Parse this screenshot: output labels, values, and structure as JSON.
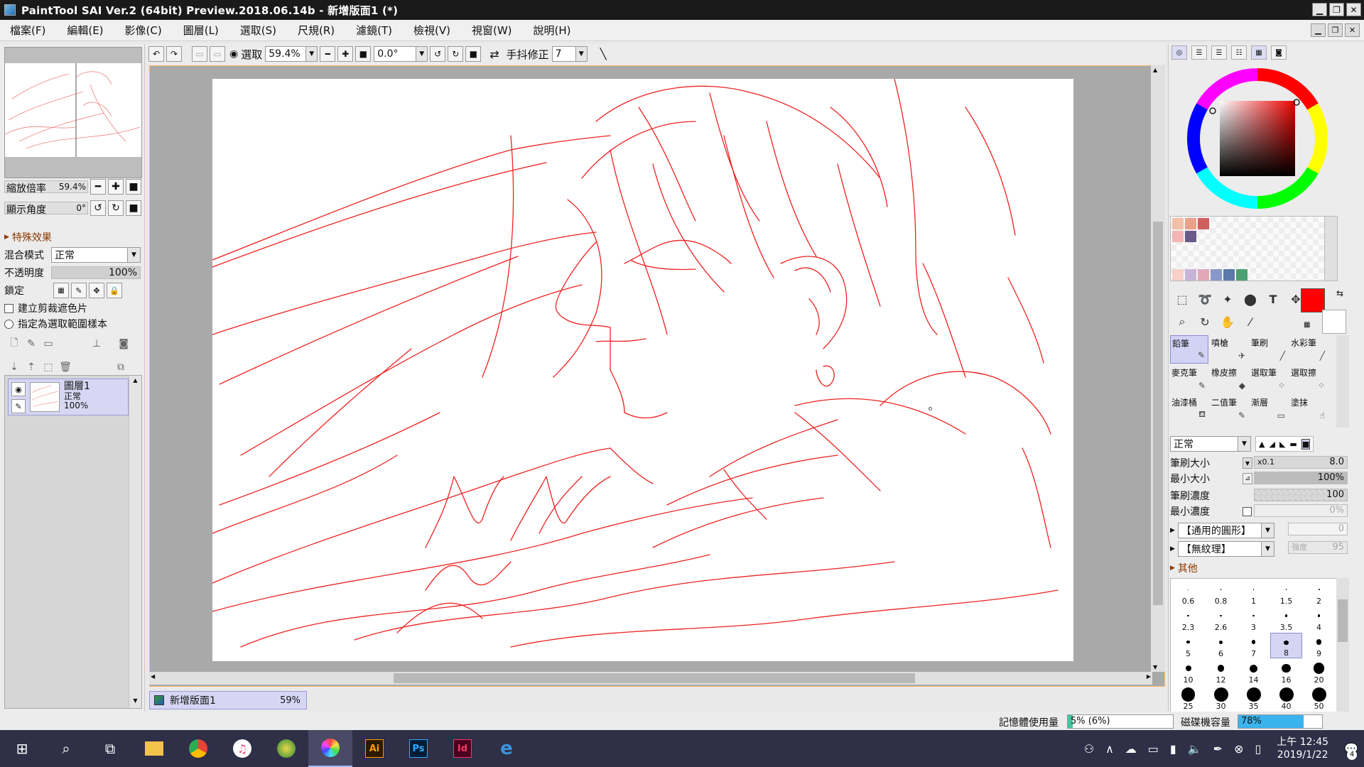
{
  "window": {
    "title": "PaintTool SAI Ver.2 (64bit) Preview.2018.06.14b - 新增版面1 (*)"
  },
  "menu": [
    "檔案(F)",
    "編輯(E)",
    "影像(C)",
    "圖層(L)",
    "選取(S)",
    "尺規(R)",
    "濾鏡(T)",
    "檢視(V)",
    "視窗(W)",
    "說明(H)"
  ],
  "left": {
    "zoom_label": "縮放倍率",
    "zoom_value": "59.4%",
    "angle_label": "顯示角度",
    "angle_value": "0°",
    "effects_label": "特殊效果",
    "blend_label": "混合模式",
    "blend_value": "正常",
    "opacity_label": "不透明度",
    "opacity_value": "100%",
    "opacity_level": 100,
    "lock_label": "鎖定",
    "clip_label": "建立剪裁遮色片",
    "selection_source_label": "指定為選取範圍樣本",
    "layer": {
      "name": "圖層1",
      "mode": "正常",
      "opacity": "100%"
    }
  },
  "toolbar": {
    "selection_label": "選取",
    "zoom": "59.4%",
    "angle": "0.0°",
    "stabilizer_label": "手抖修正",
    "stabilizer_value": "7"
  },
  "document_tab": {
    "name": "新增版面1",
    "zoom": "59%"
  },
  "right": {
    "brushes": [
      {
        "name": "鉛筆",
        "icon": "✎",
        "selected": true
      },
      {
        "name": "噴槍",
        "icon": "✈"
      },
      {
        "name": "筆刷",
        "icon": "╱"
      },
      {
        "name": "水彩筆",
        "icon": "╱"
      },
      {
        "name": "麥克筆",
        "icon": "✎"
      },
      {
        "name": "橡皮擦",
        "icon": "◆"
      },
      {
        "name": "選取筆",
        "icon": "⁘"
      },
      {
        "name": "選取擦",
        "icon": "⁘"
      },
      {
        "name": "油漆桶",
        "icon": "⛾"
      },
      {
        "name": "二值筆",
        "icon": "✎"
      },
      {
        "name": "漸層",
        "icon": "▭"
      },
      {
        "name": "塗抹",
        "icon": "☝"
      }
    ],
    "blend_mode": "正常",
    "brush_size_label": "筆刷大小",
    "brush_size_mult": "x0.1",
    "brush_size_value": "8.0",
    "min_size_label": "最小大小",
    "min_size_value": "100%",
    "min_size_level": 100,
    "density_label": "筆刷濃度",
    "density_value": "100",
    "min_density_label": "最小濃度",
    "min_density_value": "0%",
    "shape_label": "【通用的圓形】",
    "shape_value": "0",
    "texture_label": "【無紋理】",
    "texture_strength_label": "強度",
    "texture_strength_value": "95",
    "other_label": "其他",
    "dot_sizes": [
      "0.6",
      "0.8",
      "1",
      "1.5",
      "2",
      "2.3",
      "2.6",
      "3",
      "3.5",
      "4",
      "5",
      "6",
      "7",
      "8",
      "9",
      "10",
      "12",
      "14",
      "16",
      "20",
      "25",
      "30",
      "35",
      "40",
      "50"
    ],
    "dot_selected": "8",
    "fg_color": "#ff0000"
  },
  "status": {
    "memory_label": "記憶體使用量",
    "memory_value": "5% (6%)",
    "memory_level": 5,
    "disk_label": "磁碟機容量",
    "disk_value": "78%",
    "disk_level": 78
  },
  "taskbar": {
    "time": "上午 12:45",
    "date": "2019/1/22",
    "notifications": "4"
  }
}
